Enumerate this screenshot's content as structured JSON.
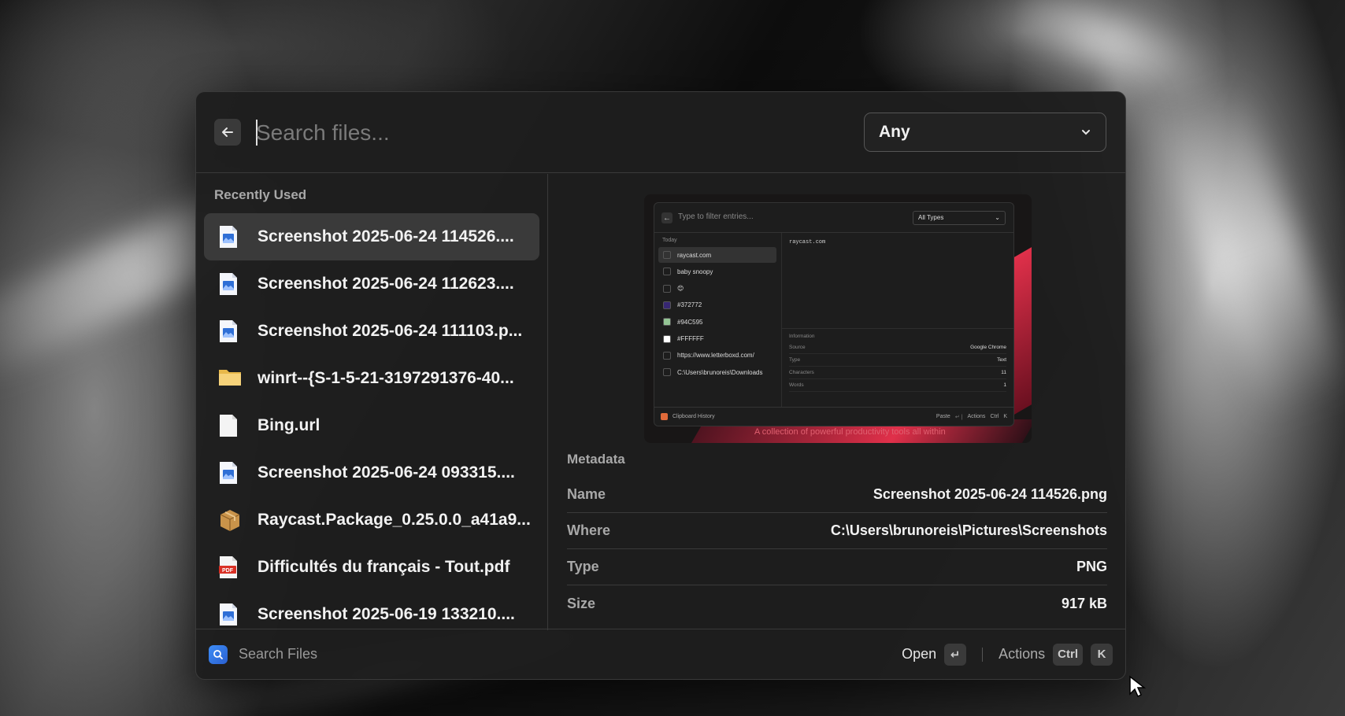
{
  "search": {
    "placeholder": "Search files..."
  },
  "filter": {
    "selected": "Any"
  },
  "recent": {
    "title": "Recently Used",
    "items": [
      {
        "label": "Screenshot 2025-06-24 114526....",
        "icon": "image-file-icon",
        "selected": true
      },
      {
        "label": "Screenshot 2025-06-24 112623....",
        "icon": "image-file-icon"
      },
      {
        "label": "Screenshot 2025-06-24 111103.p...",
        "icon": "image-file-icon"
      },
      {
        "label": "winrt--{S-1-5-21-3197291376-40...",
        "icon": "folder-icon"
      },
      {
        "label": "Bing.url",
        "icon": "blank-file-icon"
      },
      {
        "label": "Screenshot 2025-06-24 093315....",
        "icon": "image-file-icon"
      },
      {
        "label": "Raycast.Package_0.25.0.0_a41a9...",
        "icon": "package-icon"
      },
      {
        "label": "Difficultés du français - Tout.pdf",
        "icon": "pdf-file-icon"
      },
      {
        "label": "Screenshot 2025-06-19 133210....",
        "icon": "image-file-icon"
      }
    ]
  },
  "preview": {
    "mini": {
      "placeholder": "Type to filter entries...",
      "select": "All Types",
      "today": "Today",
      "items": [
        {
          "label": "raycast.com",
          "selected": true
        },
        {
          "label": "baby snoopy"
        },
        {
          "label": "😊"
        },
        {
          "label": "#372772",
          "color": "#372772"
        },
        {
          "label": "#94C595",
          "color": "#94C595"
        },
        {
          "label": "#FFFFFF",
          "color": "#FFFFFF"
        },
        {
          "label": "https://www.letterboxd.com/"
        },
        {
          "label": "C:\\Users\\brunoreis\\Downloads"
        }
      ],
      "content_text": "raycast.com",
      "info_title": "Information",
      "info": [
        {
          "k": "Source",
          "v": "Google Chrome"
        },
        {
          "k": "Type",
          "v": "Text"
        },
        {
          "k": "Characters",
          "v": "11"
        },
        {
          "k": "Words",
          "v": "1"
        }
      ],
      "footer_title": "Clipboard History",
      "footer_paste": "Paste",
      "footer_actions": "Actions",
      "footer_ctrl": "Ctrl",
      "footer_k": "K"
    },
    "caption": "A collection of powerful productivity tools all within"
  },
  "metadata": {
    "title": "Metadata",
    "rows": [
      {
        "key": "Name",
        "value": "Screenshot 2025-06-24 114526.png"
      },
      {
        "key": "Where",
        "value": "C:\\Users\\brunoreis\\Pictures\\Screenshots"
      },
      {
        "key": "Type",
        "value": "PNG"
      },
      {
        "key": "Size",
        "value": "917 kB"
      }
    ]
  },
  "footer": {
    "title": "Search Files",
    "open_label": "Open",
    "enter_key": "↵",
    "actions_label": "Actions",
    "ctrl_key": "Ctrl",
    "k_key": "K"
  },
  "colors": {
    "accent": "#3e8ef7",
    "window_bg": "#1e1e1e",
    "selected_bg": "#3a3a3a"
  }
}
